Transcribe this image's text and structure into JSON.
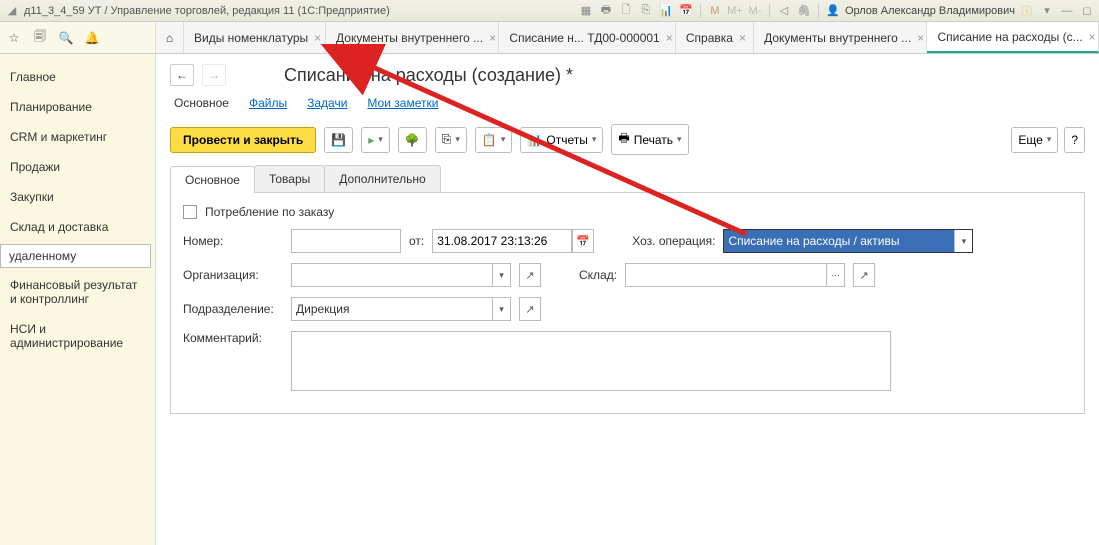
{
  "titlebar": {
    "text": "д11_3_4_59 УТ / Управление торговлей, редакция 11  (1С:Предприятие)",
    "user": "Орлов Александр Владимирович"
  },
  "tabs": [
    {
      "label": "Виды номенклатуры",
      "closable": true
    },
    {
      "label": "Документы внутреннего ...",
      "closable": true
    },
    {
      "label": "Списание н... ТД00-000001",
      "closable": true
    },
    {
      "label": "Справка",
      "closable": true
    },
    {
      "label": "Документы внутреннего ...",
      "closable": true
    },
    {
      "label": "Списание на расходы (с...",
      "closable": true,
      "active": true
    }
  ],
  "sidebar": [
    "Главное",
    "Планирование",
    "CRM и маркетинг",
    "Продажи",
    "Закупки",
    "Склад и доставка",
    "удаленному",
    "Финансовый результат и контроллинг",
    "НСИ и администрирование"
  ],
  "page": {
    "title": "Списание на расходы (создание) *",
    "links": {
      "main": "Основное",
      "files": "Файлы",
      "tasks": "Задачи",
      "notes": "Мои заметки"
    }
  },
  "toolbar": {
    "primary": "Провести и закрыть",
    "reports": "Отчеты",
    "print": "Печать",
    "more": "Еще"
  },
  "formtabs": [
    "Основное",
    "Товары",
    "Дополнительно"
  ],
  "form": {
    "consume_by_order": "Потребление по заказу",
    "number_label": "Номер:",
    "number": "",
    "from_label": "от:",
    "date": "31.08.2017 23:13:26",
    "hoz_label": "Хоз. операция:",
    "hoz_value": "Списание на расходы / активы",
    "org_label": "Организация:",
    "org": "",
    "sklad_label": "Склад:",
    "sklad": "",
    "podr_label": "Подразделение:",
    "podr": "Дирекция",
    "comment_label": "Комментарий:",
    "comment": ""
  }
}
